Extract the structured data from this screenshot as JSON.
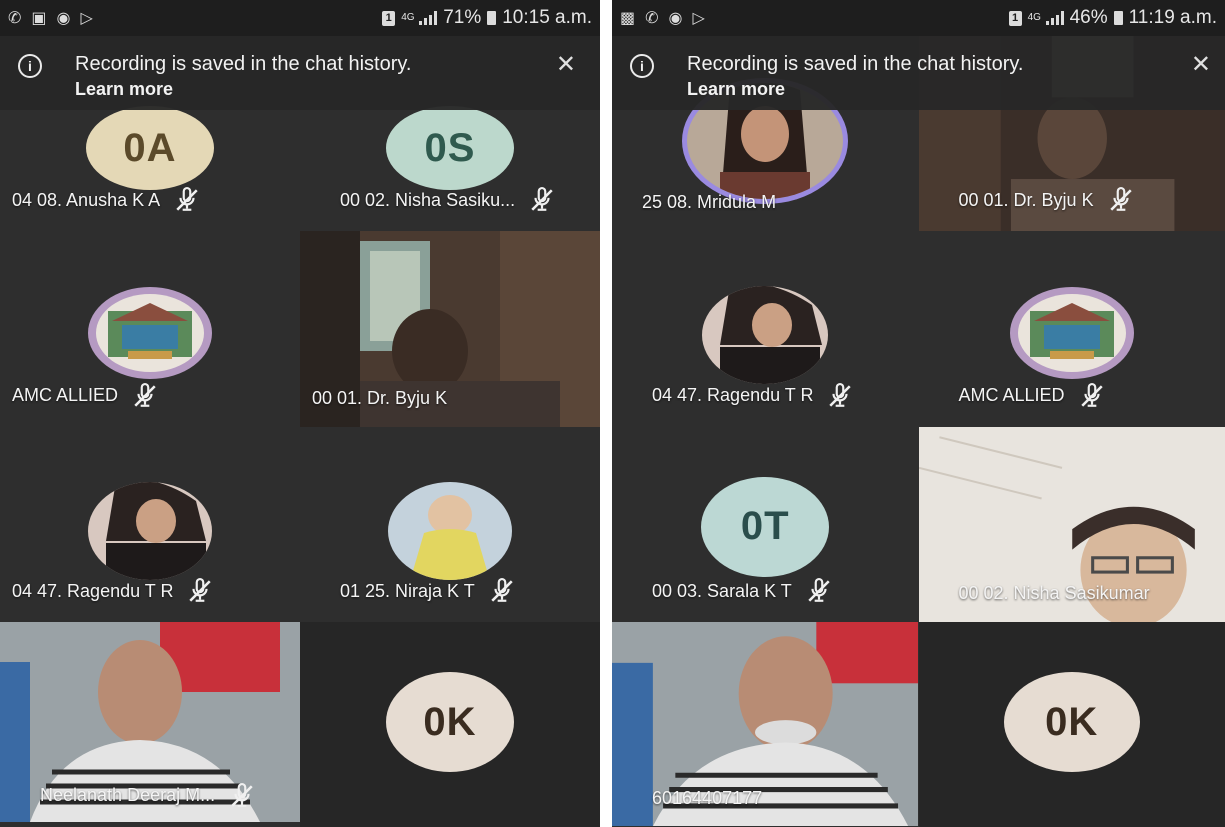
{
  "left": {
    "status": {
      "battery": "71%",
      "time": "10:15 a.m.",
      "network": "4G"
    },
    "banner": {
      "message": "Recording is saved in the chat history.",
      "link": "Learn more"
    },
    "tiles": [
      {
        "initials": "0A",
        "avatar_color": "#e4d8b6",
        "name": "04 08. Anusha K A",
        "muted": true
      },
      {
        "initials": "0S",
        "avatar_color": "#bcd8cc",
        "name": "00 02. Nisha Sasiku...",
        "muted": true
      },
      {
        "name": "AMC ALLIED",
        "muted": true,
        "type": "logo"
      },
      {
        "name": "00 01. Dr. Byju K",
        "muted": false,
        "type": "video"
      },
      {
        "name": "04 47. Ragendu T R",
        "muted": true,
        "type": "photo"
      },
      {
        "name": "01 25. Niraja K T",
        "muted": true,
        "type": "photo"
      },
      {
        "name": "Neelanath Deeraj M...",
        "muted": true,
        "type": "video"
      },
      {
        "initials": "0K",
        "avatar_color": "#e6dcd2",
        "name": "",
        "muted": false
      }
    ]
  },
  "right": {
    "status": {
      "battery": "46%",
      "time": "11:19 a.m.",
      "network": "4G"
    },
    "banner": {
      "message": "Recording is saved in the chat history.",
      "link": "Learn more"
    },
    "tiles": [
      {
        "name": "25 08. Mridula M",
        "muted": false,
        "type": "photo"
      },
      {
        "name": "00 01. Dr. Byju K",
        "muted": true,
        "type": "video"
      },
      {
        "name": "04 47. Ragendu T R",
        "muted": true,
        "type": "photo"
      },
      {
        "name": "AMC ALLIED",
        "muted": true,
        "type": "logo"
      },
      {
        "initials": "0T",
        "avatar_color": "#bcd8d4",
        "name": "00 03. Sarala K T",
        "muted": true
      },
      {
        "name": "00 02. Nisha Sasikumar",
        "muted": false,
        "type": "video"
      },
      {
        "name": "60164407177",
        "muted": false,
        "type": "video"
      },
      {
        "initials": "0K",
        "avatar_color": "#e6dcd2",
        "name": "",
        "muted": false
      }
    ]
  },
  "colors": {
    "tile_bg": "#2e2e2e",
    "banner_bg": "#282828",
    "text": "#f4f4f4"
  }
}
